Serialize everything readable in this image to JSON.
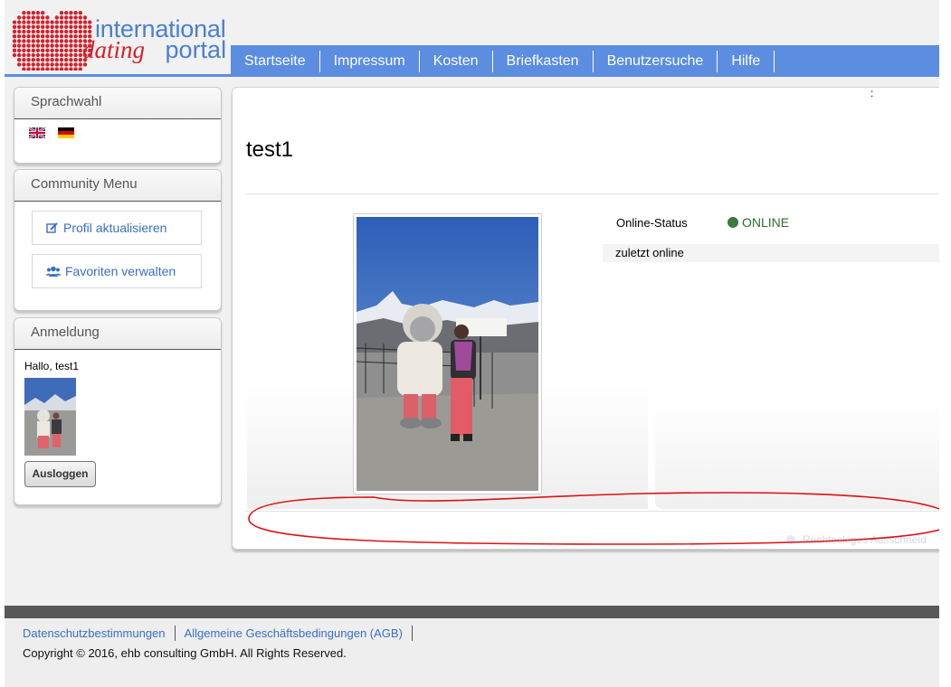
{
  "logo": {
    "line1": "international",
    "line2_accent": "dating",
    "line2_rest": "portal"
  },
  "nav": {
    "items": [
      {
        "label": "Startseite"
      },
      {
        "label": "Impressum"
      },
      {
        "label": "Kosten"
      },
      {
        "label": "Briefkasten"
      },
      {
        "label": "Benutzersuche"
      },
      {
        "label": "Hilfe"
      }
    ]
  },
  "sidebar": {
    "language": {
      "title": "Sprachwahl"
    },
    "community": {
      "title": "Community Menu",
      "items": [
        {
          "label": "Profil aktualisieren",
          "icon": "edit-icon"
        },
        {
          "label": "Favoriten verwalten",
          "icon": "users-icon"
        }
      ]
    },
    "login": {
      "title": "Anmeldung",
      "greeting": "Hallo, test1",
      "logout_label": "Ausloggen"
    }
  },
  "main": {
    "colon": ":",
    "profile_name": "test1",
    "status_label": "Online-Status",
    "status_value": "ONLINE",
    "last_online_label": "zuletzt online",
    "faded_text": "Rechteckiges Ausschneid"
  },
  "footer": {
    "links": [
      {
        "label": "Datenschutzbestimmungen"
      },
      {
        "label": "Allgemeine Geschäftsbedingungen (AGB)"
      }
    ],
    "copyright": "Copyright © 2016, ehb consulting GmbH. All Rights Reserved."
  },
  "colors": {
    "nav_blue": "#5b8de0",
    "logo_red": "#d6202a",
    "link_blue": "#3a6fc4",
    "online_green": "#3d7a3d",
    "annotation_red": "#e01010"
  }
}
